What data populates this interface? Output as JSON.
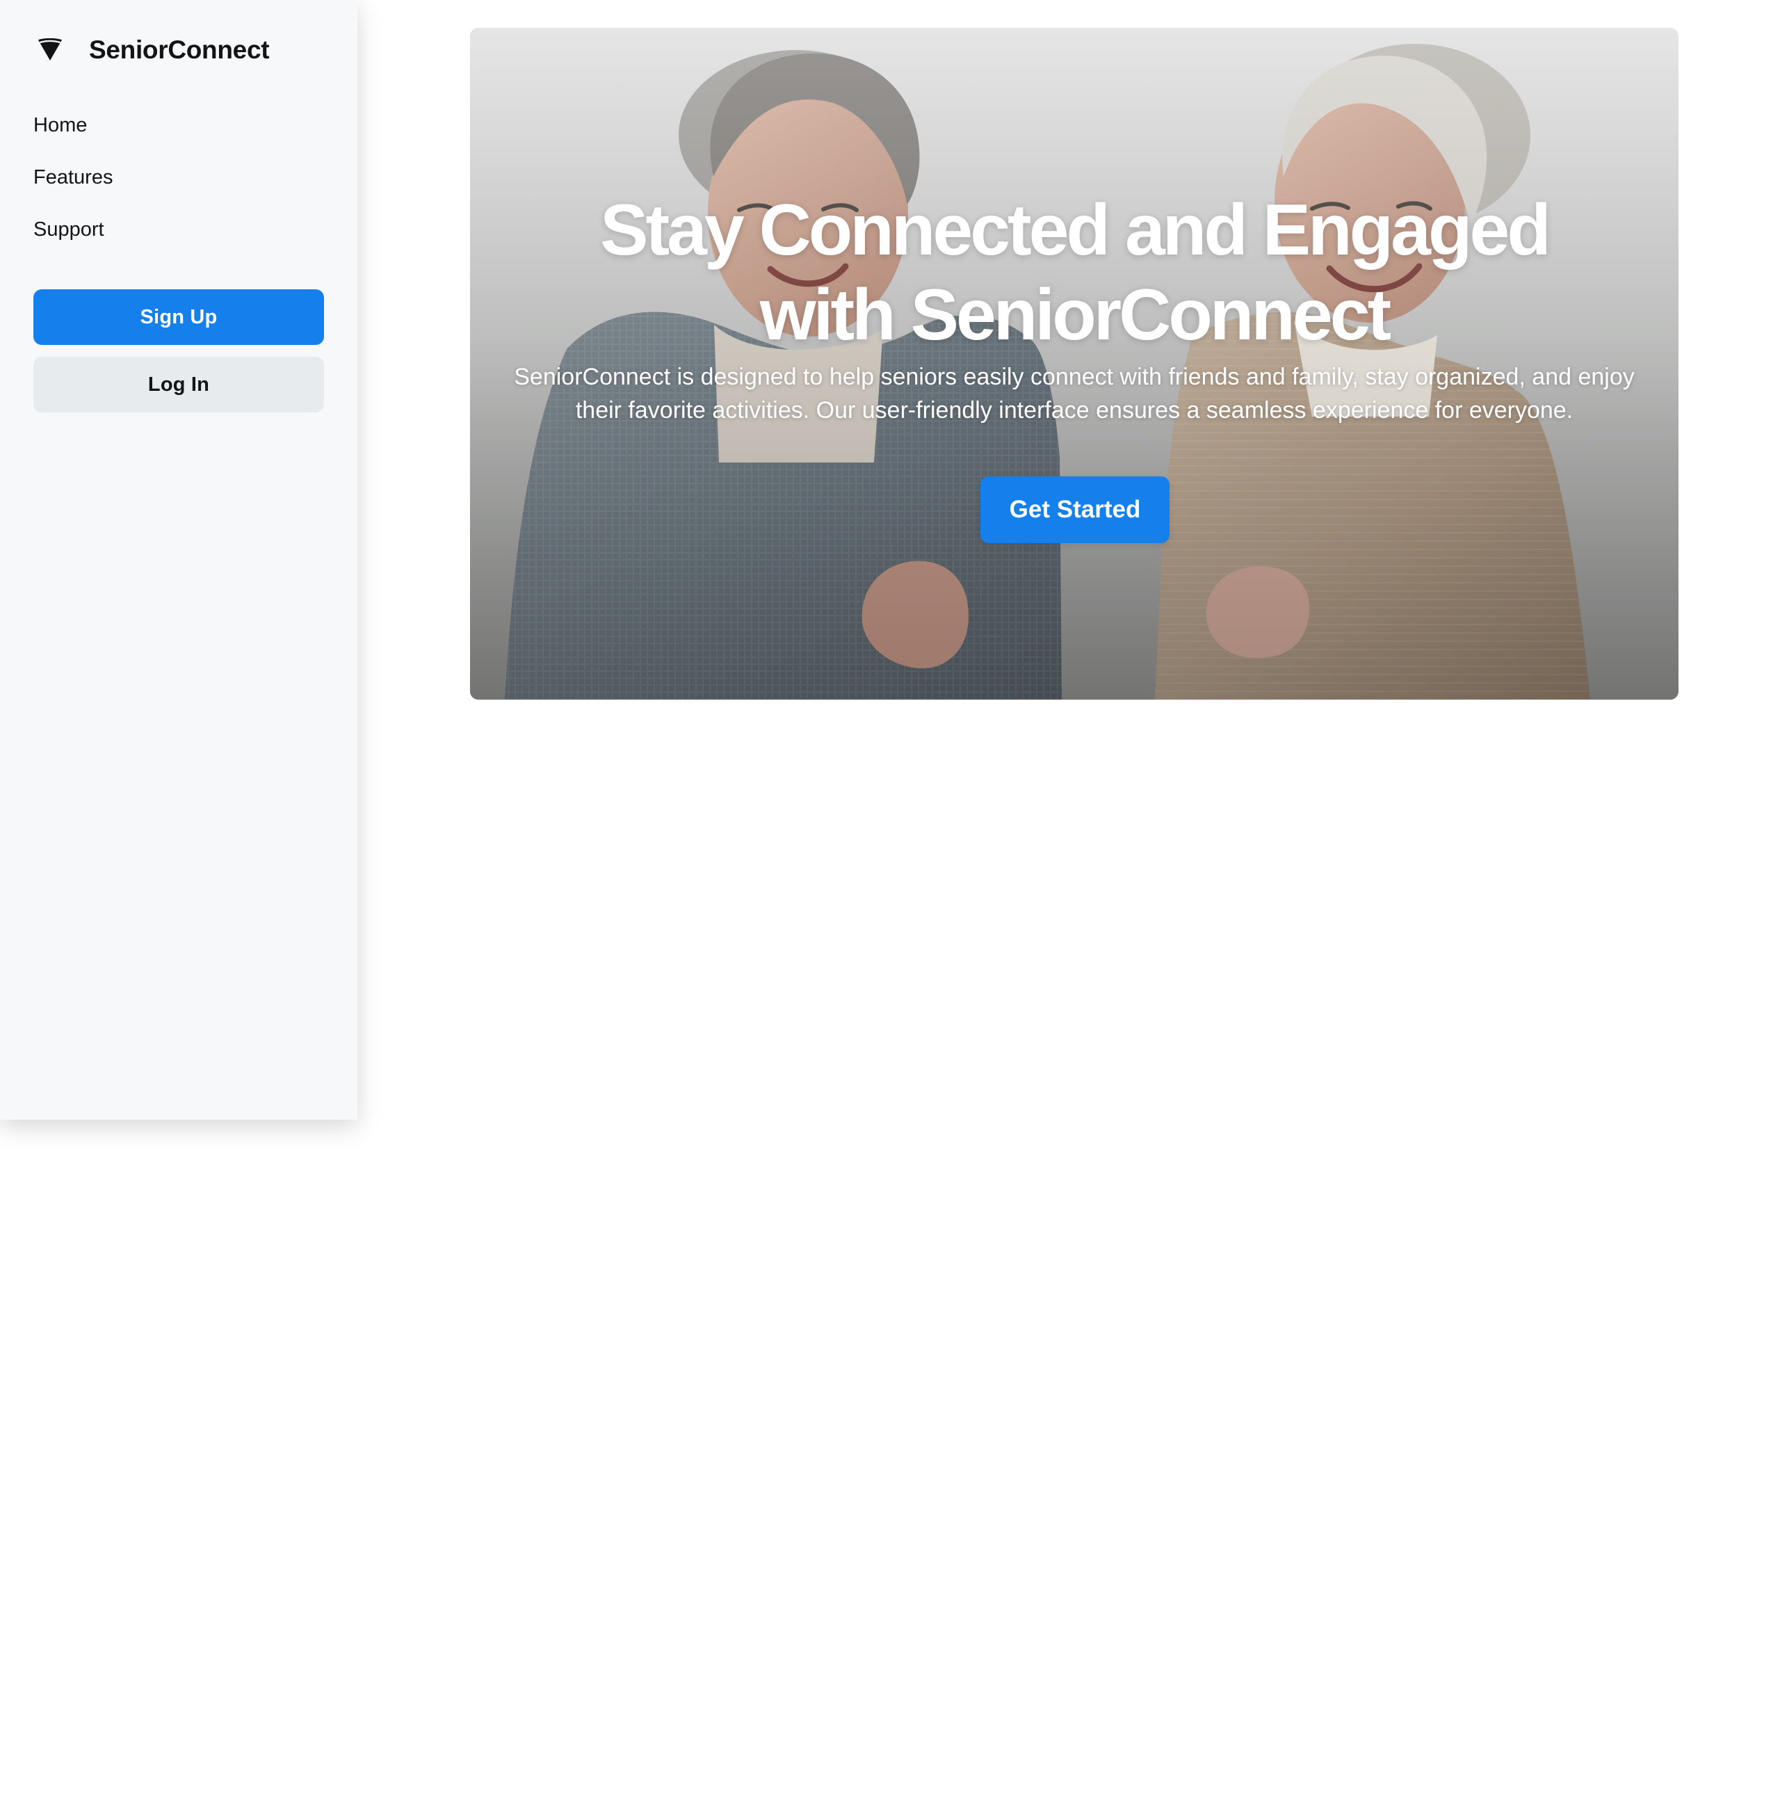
{
  "brand": {
    "name": "SeniorConnect",
    "icon": "triangle-logo-icon"
  },
  "sidebar": {
    "nav": [
      {
        "label": "Home"
      },
      {
        "label": "Features"
      },
      {
        "label": "Support"
      }
    ],
    "signup_label": "Sign Up",
    "login_label": "Log In"
  },
  "hero": {
    "title": "Stay Connected and Engaged with SeniorConnect",
    "subtitle": "SeniorConnect is designed to help seniors easily connect with friends and family, stay organized, and enjoy their favorite activities. Our user-friendly interface ensures a seamless experience for everyone.",
    "cta_label": "Get Started"
  },
  "colors": {
    "accent": "#1580eb",
    "sidebar_bg": "#f7f8fa",
    "secondary_button_bg": "#e8ebee",
    "text": "#121416"
  }
}
